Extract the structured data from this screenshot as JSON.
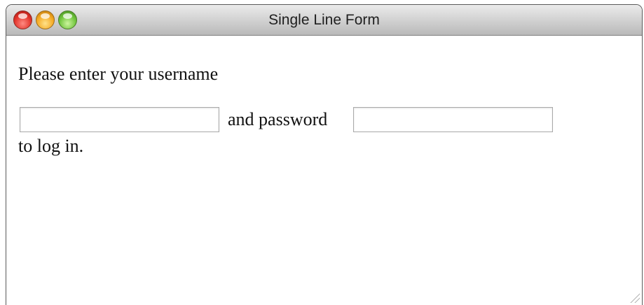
{
  "window": {
    "title": "Single Line Form",
    "controls": [
      "close",
      "minimize",
      "zoom"
    ]
  },
  "form": {
    "prompt": "Please enter your username",
    "username_value": "",
    "middle_text": "and password",
    "password_value": "",
    "tail_text": "to log in."
  },
  "colors": {
    "close": "#e2342b",
    "minimize": "#f4a923",
    "zoom": "#6fc43c"
  }
}
